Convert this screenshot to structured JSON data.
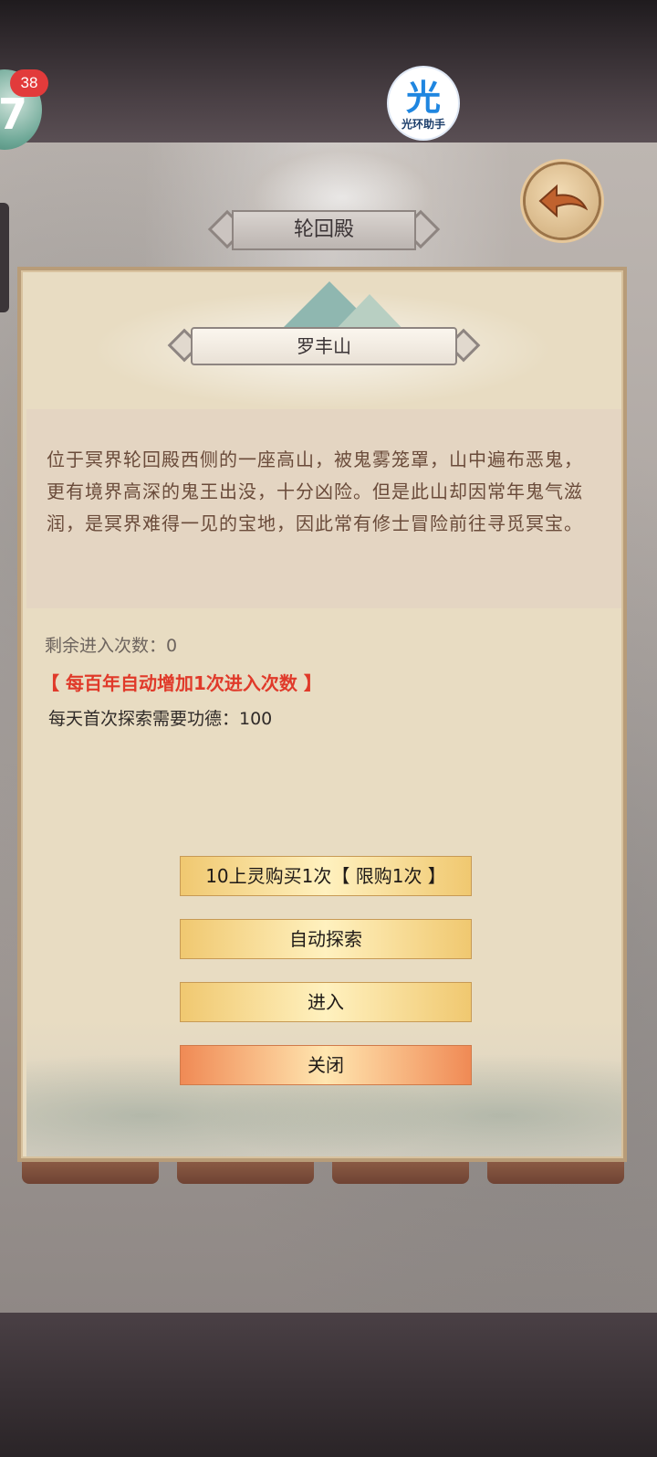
{
  "status": {
    "notification_count": "38"
  },
  "helper": {
    "glyph": "光",
    "name": "光环助手"
  },
  "header": {
    "title": "轮回殿"
  },
  "panel": {
    "location_name": "罗丰山",
    "description": "位于冥界轮回殿西侧的一座高山，被鬼雾笼罩，山中遍布恶鬼，更有境界高深的鬼王出没，十分凶险。但是此山却因常年鬼气滋润，是冥界难得一见的宝地，因此常有修士冒险前往寻觅冥宝。",
    "remaining_entries": "剩余进入次数：0",
    "auto_increase_note": "【 每百年自动增加1次进入次数 】",
    "daily_cost": "每天首次探索需要功德：100"
  },
  "buttons": {
    "buy": "10上灵购买1次【 限购1次 】",
    "auto_explore": "自动探索",
    "enter": "进入",
    "close": "关闭"
  },
  "icons": {
    "back": "back-arrow-icon",
    "avatar": "avatar-icon"
  },
  "colors": {
    "accent_red": "#e03a2a",
    "button_gold": "#f0c870",
    "button_close": "#f08a55",
    "badge": "#e23b3b"
  }
}
